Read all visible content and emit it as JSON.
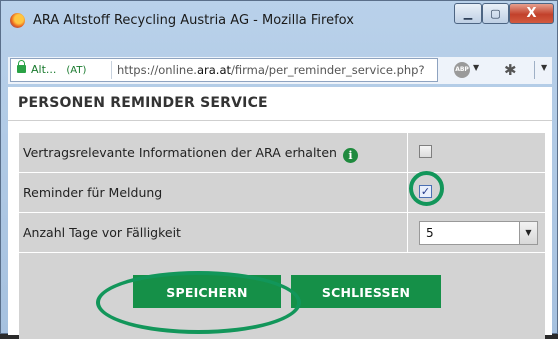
{
  "window": {
    "title": "ARA Altstoff Recycling Austria AG - Mozilla Firefox",
    "minimize_symbol": "▁",
    "maximize_symbol": "▢",
    "close_symbol": "X"
  },
  "addressbar": {
    "site_identity": "Alt...",
    "country": "(AT)",
    "url_prefix": "https://online.",
    "url_domain": "ara.at",
    "url_path": "/firma/per_reminder_service.php?",
    "abp_label": "ABP"
  },
  "page": {
    "title": "PERSONEN REMINDER SERVICE",
    "rows": [
      {
        "label": "Vertragsrelevante Informationen der ARA erhalten",
        "checked": false
      },
      {
        "label": "Reminder für Meldung",
        "checked": true
      },
      {
        "label": "Anzahl Tage vor Fälligkeit",
        "select_value": "5"
      }
    ],
    "info_symbol": "i",
    "check_mark": "✓",
    "select_arrow": "▼",
    "buttons": {
      "save": "SPEICHERN",
      "close": "SCHLIESSEN"
    }
  },
  "colors": {
    "accent_green": "#159048",
    "highlight_ring": "#12965a"
  }
}
